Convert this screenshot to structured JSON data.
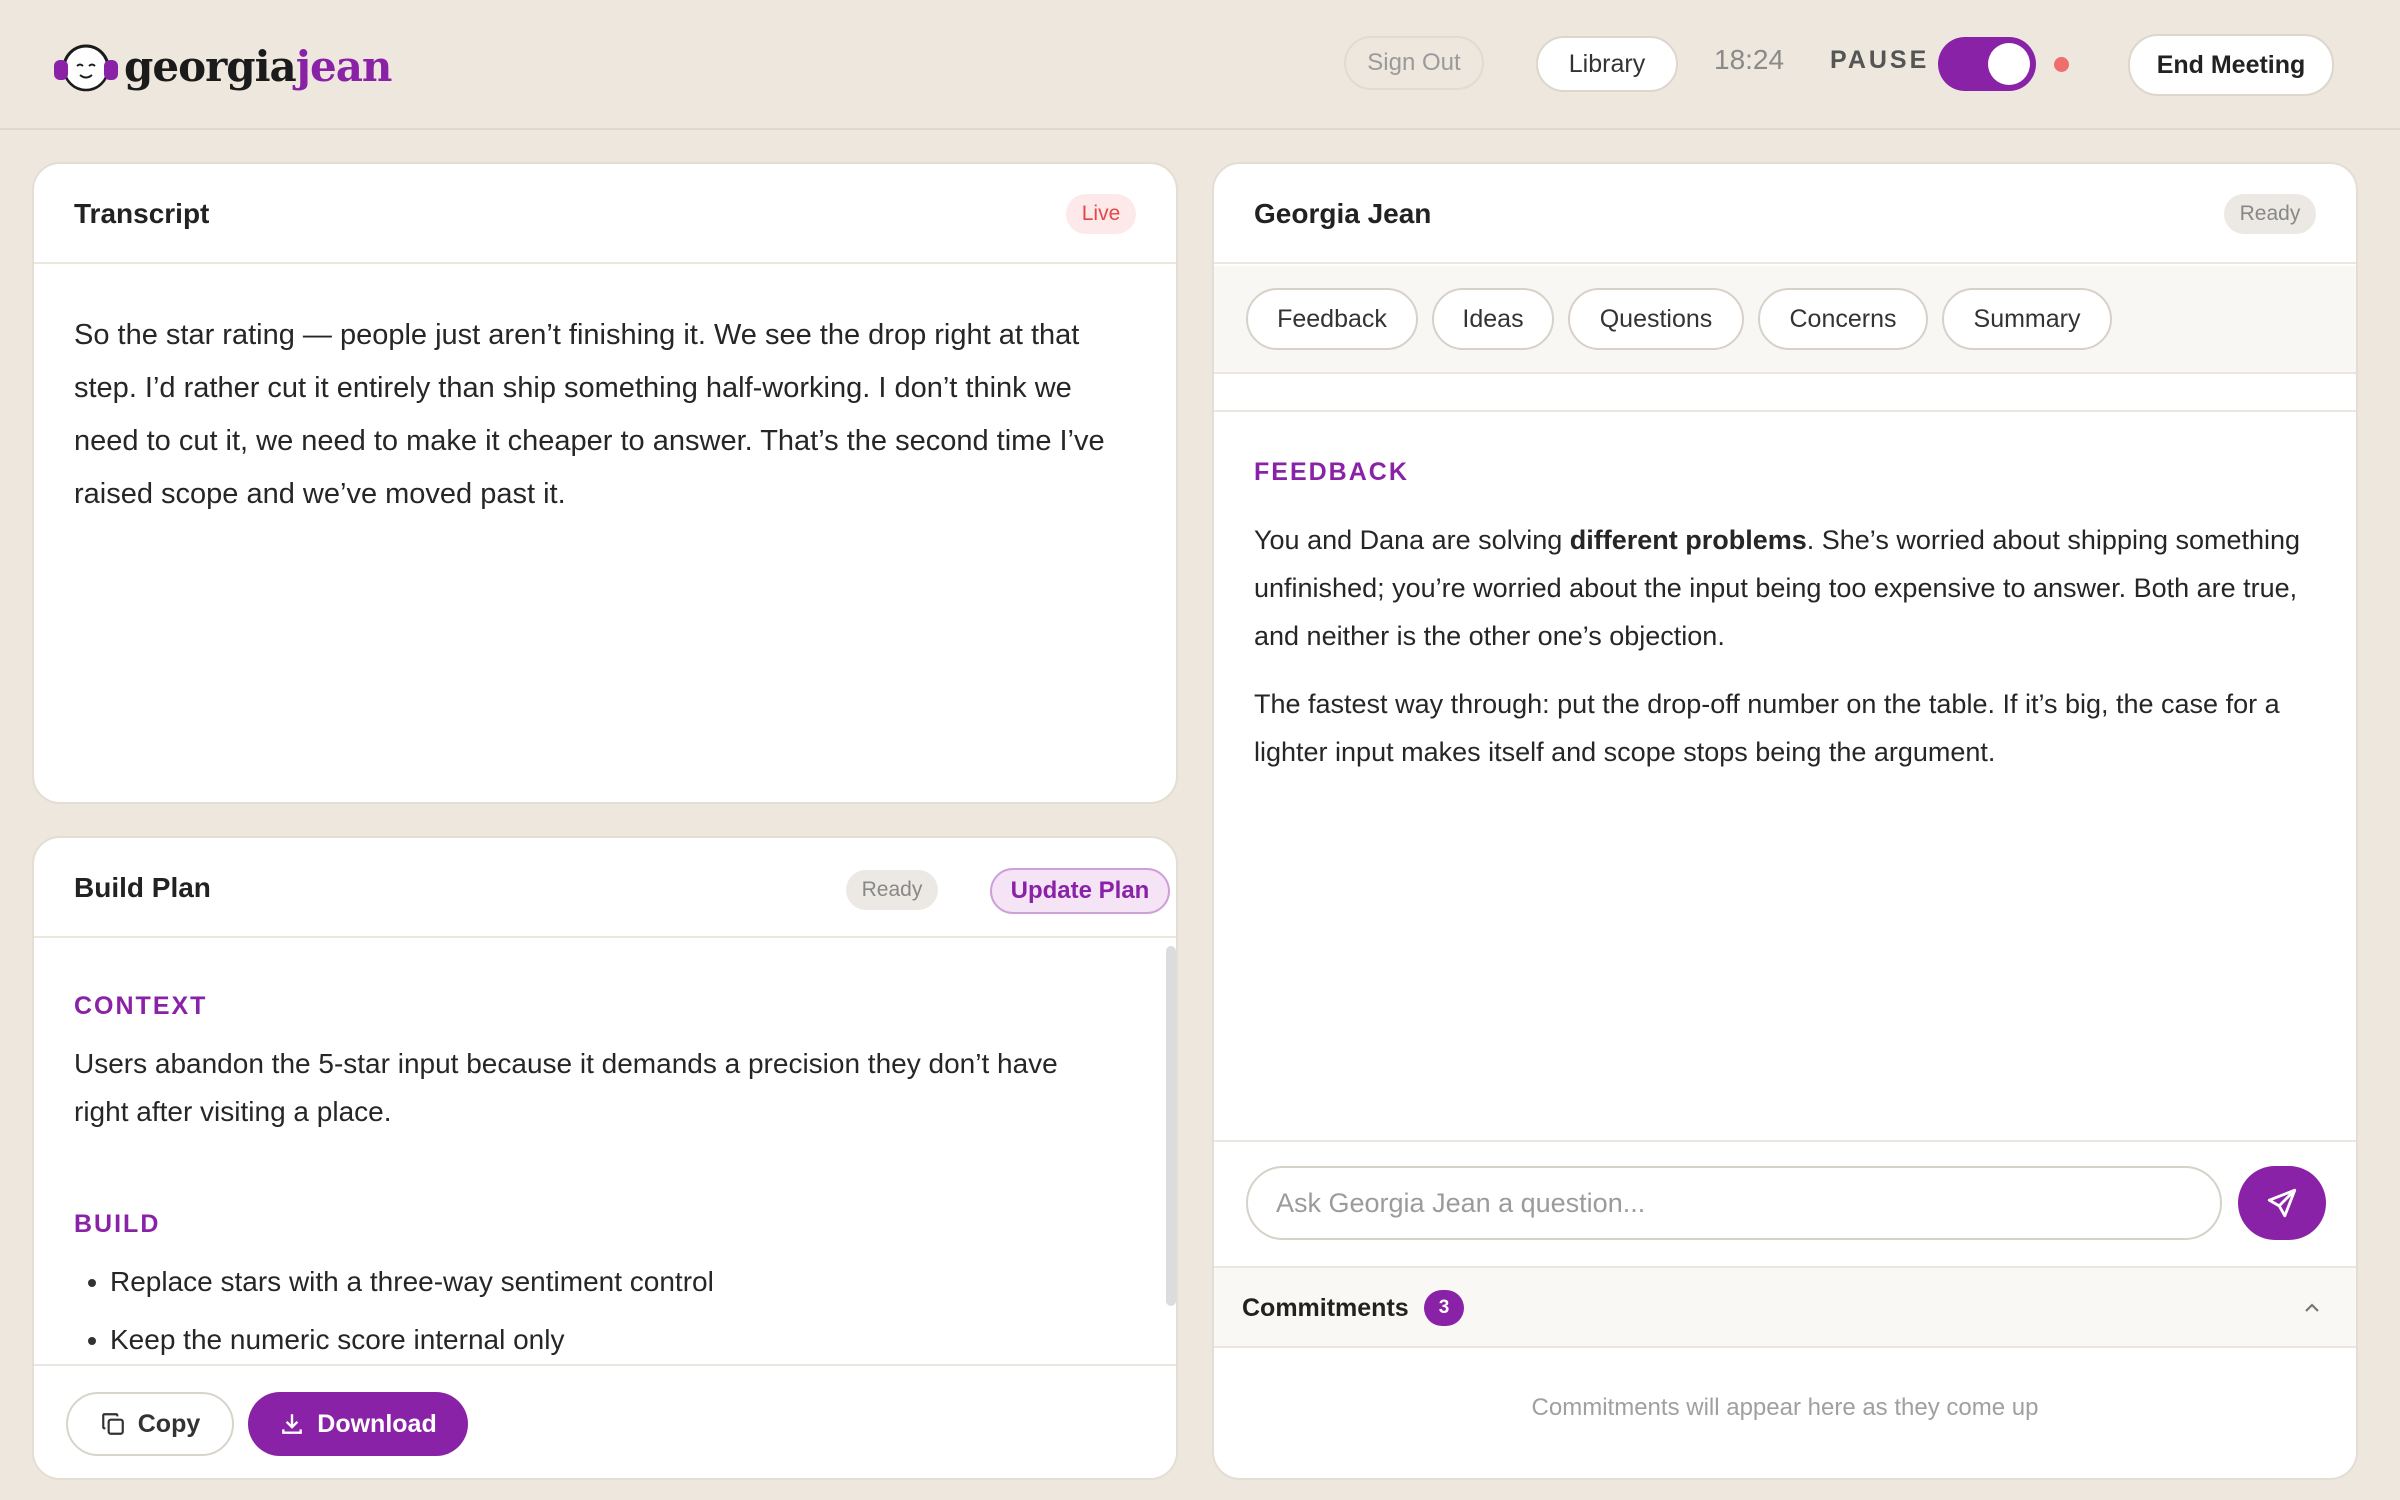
{
  "header": {
    "logo": {
      "part1": "georgia",
      "part2": "jean"
    },
    "sign_out": "Sign Out",
    "library": "Library",
    "timer": "18:24",
    "pause_label": "PAUSE",
    "pause_toggle_on": true,
    "end_meeting": "End Meeting"
  },
  "transcript": {
    "title": "Transcript",
    "status": "Live",
    "text": "So the star rating — people just aren’t finishing it. We see the drop right at that step. I’d rather cut it entirely than ship something half-working. I don’t think we need to cut it, we need to make it cheaper to answer. That’s the second time I’ve raised scope and we’ve moved past it."
  },
  "build_plan": {
    "title": "Build Plan",
    "status": "Ready",
    "update_button": "Update Plan",
    "context_heading": "CONTEXT",
    "context_text": "Users abandon the 5-star input because it demands a precision they don’t have right after visiting a place.",
    "build_heading": "BUILD",
    "build_items": [
      "Replace stars with a three-way sentiment control",
      "Keep the numeric score internal only"
    ],
    "copy_button": "Copy",
    "download_button": "Download"
  },
  "assistant": {
    "title": "Georgia Jean",
    "status": "Ready",
    "tabs": [
      "Feedback",
      "Ideas",
      "Questions",
      "Concerns",
      "Summary"
    ],
    "section_heading": "FEEDBACK",
    "para1_before": "You and Dana are solving ",
    "para1_bold": "different problems",
    "para1_after": ". She’s worried about shipping something unfinished; you’re worried about the input being too expensive to answer. Both are true, and neither is the other one’s objection.",
    "para2": "The fastest way through: put the drop-off number on the table. If it’s big, the case for a lighter input makes itself and scope stops being the argument.",
    "ask_placeholder": "Ask Georgia Jean a question..."
  },
  "commitments": {
    "title": "Commitments",
    "count": "3",
    "empty_text": "Commitments will appear here as they come up"
  },
  "colors": {
    "accent": "#8a22a8",
    "background": "#ede7dd",
    "live": "#e24848"
  }
}
